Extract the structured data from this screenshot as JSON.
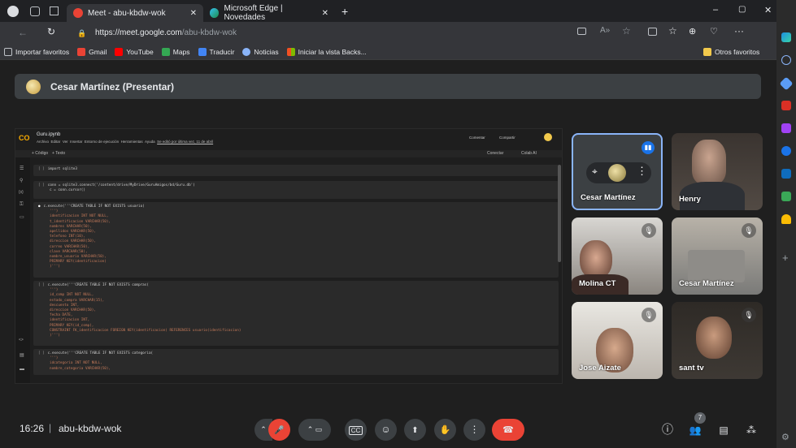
{
  "browser": {
    "tabs": [
      {
        "title": "Meet - abu-kbdw-wok",
        "active": true
      },
      {
        "title": "Microsoft Edge | Novedades",
        "active": false
      }
    ],
    "new_tab": "+",
    "url_host": "https://meet.google.com",
    "url_path": "/abu-kbdw-wok",
    "favorites": [
      "Importar favoritos",
      "Gmail",
      "YouTube",
      "Maps",
      "Traducir",
      "Noticias",
      "Iniciar la vista Backs..."
    ],
    "other_favorites": "Otros favoritos",
    "window_controls": {
      "minimize": "–",
      "restore": "▢",
      "close": "✕"
    }
  },
  "meet": {
    "presenter_banner": "Cesar Martínez (Presentar)",
    "participants": [
      {
        "name": "Cesar Martínez",
        "muted": false
      },
      {
        "name": "Henry",
        "muted": false
      },
      {
        "name": "Molina CT",
        "muted": true
      },
      {
        "name": "Cesar Martínez",
        "muted": true
      },
      {
        "name": "Jose Aizate",
        "muted": true
      },
      {
        "name": "sant tv",
        "muted": true
      }
    ],
    "time": "16:26",
    "divider": "|",
    "meeting_code": "abu-kbdw-wok",
    "participant_count": "7"
  },
  "colab": {
    "filename": "Guru.ipynb",
    "menu": [
      "Archivo",
      "Editar",
      "Ver",
      "Insertar",
      "Entorno de ejecución",
      "Herramientas",
      "Ayuda"
    ],
    "last_edit": "Se editó por última vez, 11 de abril",
    "toolbar": [
      "+ Código",
      "+ Texto"
    ],
    "actions": [
      "Comentar",
      "Compartir"
    ],
    "connect": "Conectar",
    "gemini": "Colab AI",
    "cells": [
      {
        "lines": [
          "import sqlite3"
        ]
      },
      {
        "lines": [
          "conn = sqlite3.connect('/content/drive/MyDrive/GuruAmigos/bd/Guru.db')",
          "c = conn.cursor()"
        ]
      },
      {
        "lines": [
          "c.execute('''CREATE TABLE IF NOT EXISTS usuario(",
          "    ''')",
          "    identificacion INT NOT NULL,",
          "    t_identificacion VARCHAR(50),",
          "    nombres VARCHAR(50),",
          "    apellidos VARCHAR(50),",
          "    telefono INT(10),",
          "    direccion VARCHAR(50),",
          "    correo VARCHAR(50),",
          "    clave VARCHAR(50),",
          "    nombre_usuario VARCHAR(50),",
          "    PRIMARY KEY(identificacion)",
          "    )''')"
        ]
      },
      {
        "lines": [
          "c.execute('''CREATE TABLE IF NOT EXISTS compras(",
          "    ''')",
          "    id_comp INT NOT NULL,",
          "    estado_compra VARCHAR(15),",
          "    descuento INT,",
          "    direccion VARCHAR(50),",
          "    fecha DATE,",
          "    identificacion INT,",
          "    PRIMARY KEY(id_comp),",
          "    CONSTRAINT FK_identificacion FOREIGN KEY(identificacion) REFERENCES usuario(identificacion)",
          "    )''')"
        ]
      },
      {
        "lines": [
          "c.execute('''CREATE TABLE IF NOT EXISTS categoria(",
          "    ''')",
          "    idcategoria INT NOT NULL,",
          "    nombre_categoria VARCHAR(50),"
        ]
      }
    ]
  },
  "icons": {
    "mic_off": "🎤",
    "present": "⬆",
    "raise_hand": "✋",
    "more": "⋮",
    "end_call": "☎",
    "info": "ⓘ",
    "people": "👥",
    "chat": "💬",
    "activities": "⚙"
  },
  "colors": {
    "end_call": "#ea4335",
    "mic_off": "#ea4335",
    "active_tile_border": "#8ab4f8"
  }
}
